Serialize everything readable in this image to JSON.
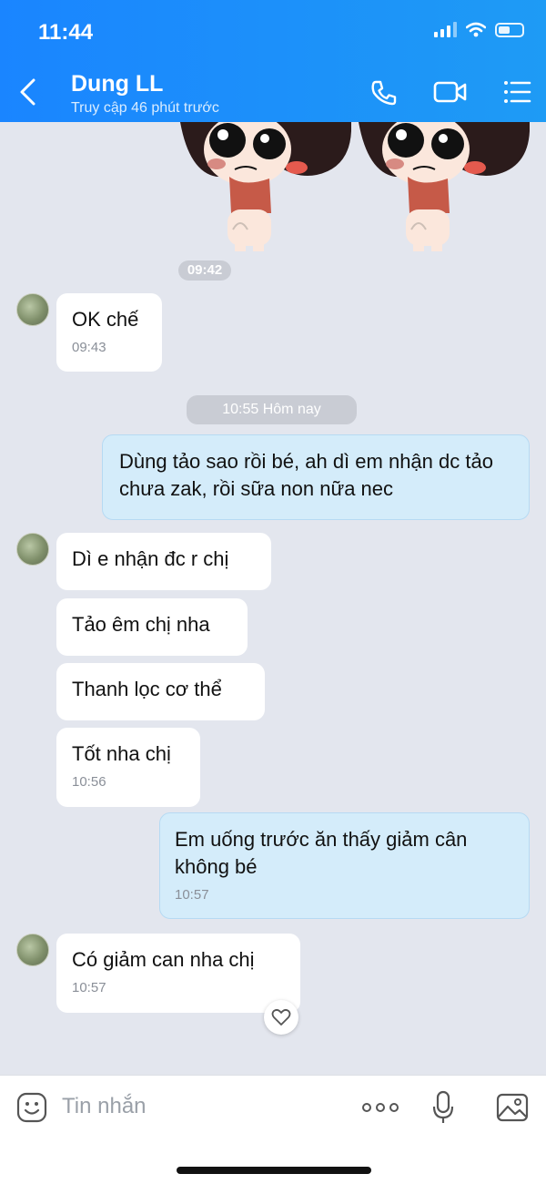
{
  "status": {
    "time": "11:44"
  },
  "header": {
    "title": "Dung LL",
    "subtitle": "Truy cập 46 phút trước"
  },
  "chat": {
    "sticker_time": "09:42",
    "msg1": {
      "text": "OK chế",
      "time": "09:43"
    },
    "separator": "10:55 Hôm nay",
    "msg2": {
      "text": "Dùng tảo sao rồi bé, ah dì em nhận dc tảo chưa zak, rồi sữa non nữa nec"
    },
    "msg3": {
      "text": "Dì e nhận đc r chị"
    },
    "msg4": {
      "text": "Tảo êm chị nha"
    },
    "msg5": {
      "text": "Thanh lọc cơ thể"
    },
    "msg6": {
      "text": "Tốt nha chị",
      "time": "10:56"
    },
    "msg7": {
      "text": "Em uống trước ăn thấy giảm cân không bé",
      "time": "10:57"
    },
    "msg8": {
      "text": "Có giảm can nha chị",
      "time": "10:57"
    }
  },
  "composer": {
    "placeholder": "Tin nhắn"
  },
  "colors": {
    "header": "#1a85ff",
    "outgoing": "#d4ecfa",
    "incoming": "#ffffff",
    "background": "#e3e6ee"
  }
}
